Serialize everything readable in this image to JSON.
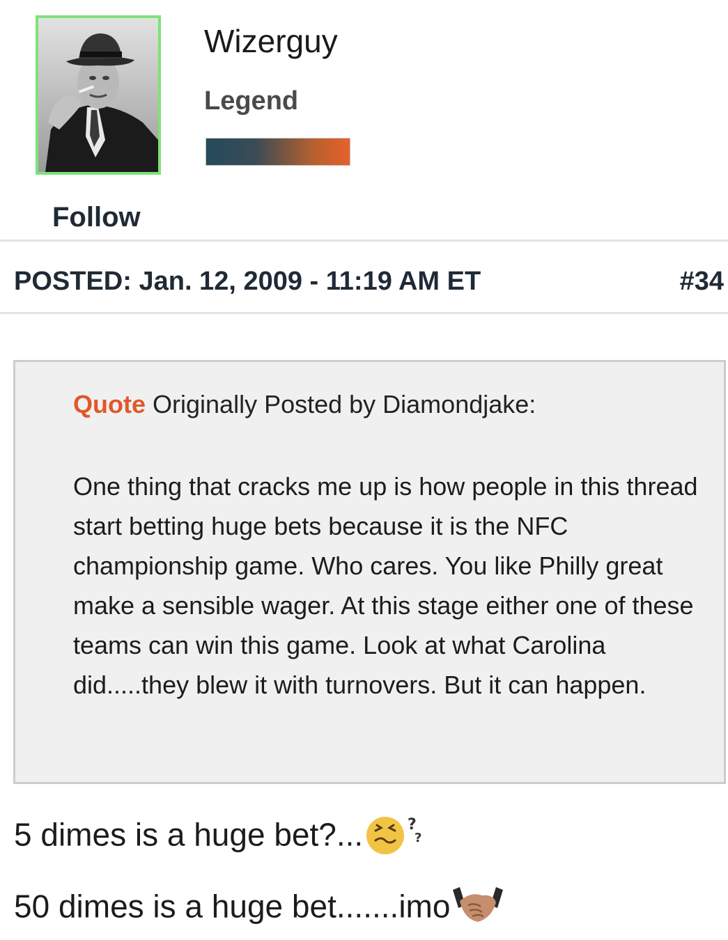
{
  "user": {
    "name": "Wizerguy",
    "rank": "Legend",
    "follow_label": "Follow",
    "avatar_border_color": "#7ee27a",
    "rank_bar_colors": [
      "#254a5c",
      "#e6612a"
    ]
  },
  "post": {
    "posted_label": "POSTED: Jan. 12, 2009 - 11:19 AM ET",
    "number": "#34"
  },
  "quote": {
    "label": "Quote",
    "attribution": "Originally Posted by Diamondjake:",
    "label_color": "#e0582a",
    "body": "One thing that cracks me up is how people in this thread start betting huge bets because it is the NFC championship game. Who cares. You like Philly great make a sensible wager. At this stage either one of these teams can win this game. Look at what Carolina did.....they blew it with turnovers. But it can happen."
  },
  "reply": {
    "line1": "5 dimes is a huge bet?...",
    "line2": "50 dimes  is a huge bet.......imo",
    "emoji1": "confused-face-icon",
    "emoji2": "handshake-icon"
  }
}
